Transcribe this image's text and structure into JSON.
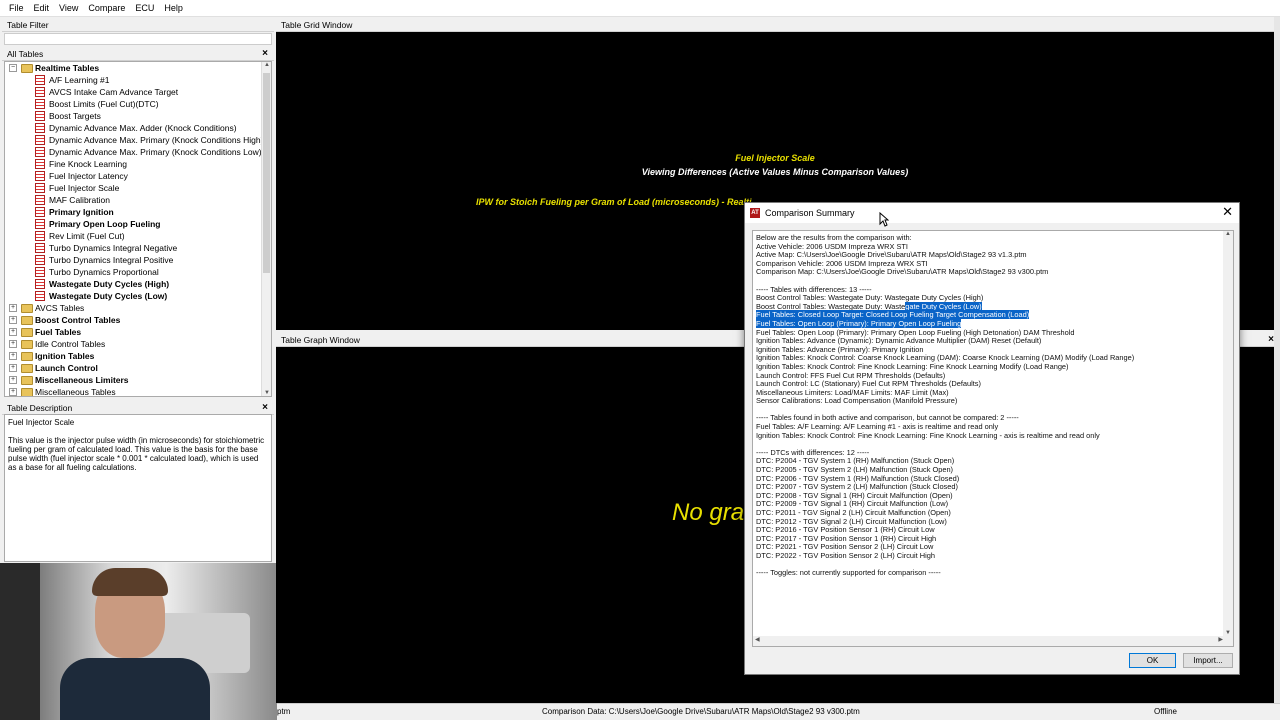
{
  "menu": [
    "File",
    "Edit",
    "View",
    "Compare",
    "ECU",
    "Help"
  ],
  "table_filter": {
    "title": "Table Filter"
  },
  "all_tables": {
    "title": "All Tables"
  },
  "tree": [
    {
      "label": "Realtime Tables",
      "type": "folder",
      "open": true,
      "bold": true,
      "level": 0
    },
    {
      "label": "A/F Learning #1",
      "type": "table",
      "bold": false,
      "level": 1
    },
    {
      "label": "AVCS Intake Cam Advance Target",
      "type": "table",
      "bold": false,
      "level": 1
    },
    {
      "label": "Boost Limits (Fuel Cut)(DTC)",
      "type": "table",
      "bold": false,
      "level": 1
    },
    {
      "label": "Boost Targets",
      "type": "table",
      "bold": false,
      "level": 1
    },
    {
      "label": "Dynamic Advance Max. Adder (Knock Conditions)",
      "type": "table",
      "bold": false,
      "level": 1
    },
    {
      "label": "Dynamic Advance Max. Primary (Knock Conditions High)",
      "type": "table",
      "bold": false,
      "level": 1
    },
    {
      "label": "Dynamic Advance Max. Primary (Knock Conditions Low)",
      "type": "table",
      "bold": false,
      "level": 1
    },
    {
      "label": "Fine Knock Learning",
      "type": "table",
      "bold": false,
      "level": 1
    },
    {
      "label": "Fuel Injector Latency",
      "type": "table",
      "bold": false,
      "level": 1
    },
    {
      "label": "Fuel Injector Scale",
      "type": "table",
      "bold": false,
      "level": 1
    },
    {
      "label": "MAF Calibration",
      "type": "table",
      "bold": false,
      "level": 1
    },
    {
      "label": "Primary Ignition",
      "type": "table",
      "bold": true,
      "level": 1
    },
    {
      "label": "Primary Open Loop Fueling",
      "type": "table",
      "bold": true,
      "level": 1
    },
    {
      "label": "Rev Limit (Fuel Cut)",
      "type": "table",
      "bold": false,
      "level": 1
    },
    {
      "label": "Turbo Dynamics Integral Negative",
      "type": "table",
      "bold": false,
      "level": 1
    },
    {
      "label": "Turbo Dynamics Integral Positive",
      "type": "table",
      "bold": false,
      "level": 1
    },
    {
      "label": "Turbo Dynamics Proportional",
      "type": "table",
      "bold": false,
      "level": 1
    },
    {
      "label": "Wastegate Duty Cycles (High)",
      "type": "table",
      "bold": true,
      "level": 1
    },
    {
      "label": "Wastegate Duty Cycles (Low)",
      "type": "table",
      "bold": true,
      "level": 1
    },
    {
      "label": "AVCS Tables",
      "type": "folder",
      "open": false,
      "bold": false,
      "level": 0
    },
    {
      "label": "Boost Control Tables",
      "type": "folder",
      "open": false,
      "bold": true,
      "level": 0
    },
    {
      "label": "Fuel Tables",
      "type": "folder",
      "open": false,
      "bold": true,
      "level": 0
    },
    {
      "label": "Idle Control Tables",
      "type": "folder",
      "open": false,
      "bold": false,
      "level": 0
    },
    {
      "label": "Ignition Tables",
      "type": "folder",
      "open": false,
      "bold": true,
      "level": 0
    },
    {
      "label": "Launch Control",
      "type": "folder",
      "open": false,
      "bold": true,
      "level": 0
    },
    {
      "label": "Miscellaneous Limiters",
      "type": "folder",
      "open": false,
      "bold": true,
      "level": 0
    },
    {
      "label": "Miscellaneous Tables",
      "type": "folder",
      "open": false,
      "bold": false,
      "level": 0
    }
  ],
  "table_description": {
    "title": "Table Description",
    "name": "Fuel Injector Scale",
    "text": "This value is the injector pulse width (in microseconds) for stoichiometric fueling per gram of calculated load. This value is the basis for the base pulse width (fuel injector scale * 0.001 * calculated load), which is used as a base for all fueling calculations."
  },
  "grid_window": {
    "title": "Table Grid Window",
    "table_name": "Fuel Injector Scale",
    "subtitle": "Viewing Differences (Active Values Minus Comparison Values)",
    "ipw_label": "IPW for Stoich Fueling per Gram of Load (microseconds) - Realti"
  },
  "graph_window": {
    "title": "Table Graph Window",
    "no_graph": "No gra"
  },
  "dialog": {
    "title": "Comparison Summary",
    "lines": [
      {
        "t": "Below are the results from the comparison with:"
      },
      {
        "t": "Active Vehicle: 2006 USDM Impreza WRX STI"
      },
      {
        "t": "Active Map: C:\\Users\\Joe\\Google Drive\\Subaru\\ATR Maps\\Old\\Stage2 93 v1.3.ptm"
      },
      {
        "t": "Comparison Vehicle: 2006 USDM Impreza WRX STI"
      },
      {
        "t": "Comparison Map: C:\\Users\\Joe\\Google Drive\\Subaru\\ATR Maps\\Old\\Stage2 93 v300.ptm"
      },
      {
        "t": ""
      },
      {
        "t": "----- Tables with differences: 13 -----"
      },
      {
        "t": "Boost Control Tables: Wastegate Duty: Wastegate Duty Cycles (High)"
      },
      {
        "t": "Boost Control Tables: Wastegate Duty: Waste",
        "hl": "gate Duty Cycles (Low)"
      },
      {
        "t": "",
        "hl": "Fuel Tables: Closed Loop Target: Closed Loop Fueling Target Compensation (Load)"
      },
      {
        "t": "",
        "hl": "Fuel Tables: Open Loop (Primary): Primary Open Loop Fueling"
      },
      {
        "t": "Fuel Tables: Open Loop (Primary): Primary Open Loop Fueling (High Detonation) DAM Threshold"
      },
      {
        "t": "Ignition Tables: Advance (Dynamic): Dynamic Advance Multiplier (DAM) Reset (Default)"
      },
      {
        "t": "Ignition Tables: Advance (Primary): Primary Ignition"
      },
      {
        "t": "Ignition Tables: Knock Control: Coarse Knock Learning (DAM): Coarse Knock Learning (DAM) Modify (Load Range)"
      },
      {
        "t": "Ignition Tables: Knock Control: Fine Knock Learning: Fine Knock Learning Modify (Load Range)"
      },
      {
        "t": "Launch Control: FFS Fuel Cut RPM Thresholds (Defaults)"
      },
      {
        "t": "Launch Control: LC (Stationary) Fuel Cut RPM Thresholds (Defaults)"
      },
      {
        "t": "Miscellaneous Limiters: Load/MAF Limits: MAF Limit (Max)"
      },
      {
        "t": "Sensor Calibrations: Load Compensation (Manifold Pressure)"
      },
      {
        "t": ""
      },
      {
        "t": "----- Tables found in both active and comparison, but cannot be compared: 2 -----"
      },
      {
        "t": "Fuel Tables: A/F Learning: A/F Learning #1 - axis is realtime and read only"
      },
      {
        "t": "Ignition Tables: Knock Control: Fine Knock Learning: Fine Knock Learning - axis is realtime and read only"
      },
      {
        "t": ""
      },
      {
        "t": "----- DTCs with differences: 12 -----"
      },
      {
        "t": "DTC: P2004 - TGV System 1 (RH) Malfunction (Stuck Open)"
      },
      {
        "t": "DTC: P2005 - TGV System 2 (LH) Malfunction (Stuck Open)"
      },
      {
        "t": "DTC: P2006 - TGV System 1 (RH) Malfunction (Stuck Closed)"
      },
      {
        "t": "DTC: P2007 - TGV System 2 (LH) Malfunction (Stuck Closed)"
      },
      {
        "t": "DTC: P2008 - TGV Signal 1 (RH) Circuit Malfunction (Open)"
      },
      {
        "t": "DTC: P2009 - TGV Signal 1 (RH) Circuit Malfunction (Low)"
      },
      {
        "t": "DTC: P2011 - TGV Signal 2 (LH) Circuit Malfunction (Open)"
      },
      {
        "t": "DTC: P2012 - TGV Signal 2 (LH) Circuit Malfunction (Low)"
      },
      {
        "t": "DTC: P2016 - TGV Position Sensor 1 (RH) Circuit Low"
      },
      {
        "t": "DTC: P2017 - TGV Position Sensor 1 (RH) Circuit High"
      },
      {
        "t": "DTC: P2021 - TGV Position Sensor 2 (LH) Circuit Low"
      },
      {
        "t": "DTC: P2022 - TGV Position Sensor 2 (LH) Circuit High"
      },
      {
        "t": ""
      },
      {
        "t": "----- Toggles: not currently supported for comparison -----"
      }
    ],
    "ok_label": "OK",
    "import_label": "Import..."
  },
  "status": {
    "left": "ptm",
    "comparison": "Comparison Data: C:\\Users\\Joe\\Google Drive\\Subaru\\ATR Maps\\Old\\Stage2 93 v300.ptm",
    "state": "Offline"
  },
  "colors": {
    "accent_yellow": "#e8e000",
    "highlight": "#0a64c8"
  }
}
